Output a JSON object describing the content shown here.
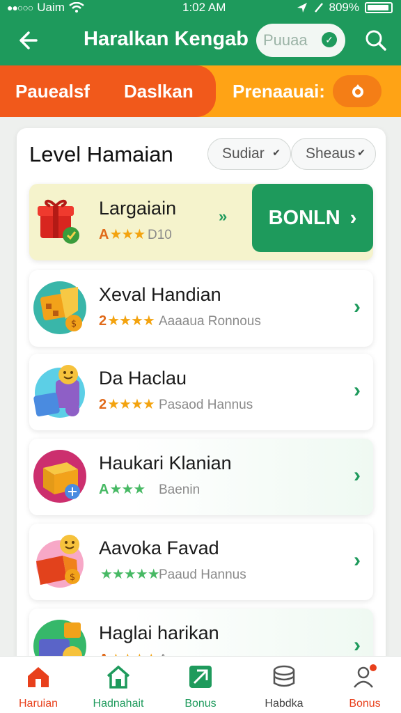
{
  "status_bar": {
    "carrier": "Uaim",
    "time": "1:02 AM",
    "battery": "809%"
  },
  "app_bar": {
    "title": "Haralkan Kengab",
    "pill_label": "Puuaa"
  },
  "tabs": [
    {
      "label": "Pauealsf"
    },
    {
      "label": "Daslkan"
    },
    {
      "label": "Prenaauai:"
    }
  ],
  "section": {
    "title": "Level Hamaian",
    "filters": [
      {
        "label": "Sudiar"
      },
      {
        "label": "Sheaus"
      }
    ]
  },
  "featured": {
    "name": "Largaiain",
    "rating_prefix": "A",
    "stars": "★★★",
    "meta": "D10",
    "action_label": "BONLN",
    "action_chevron": "›",
    "arrow": "»"
  },
  "items": [
    {
      "name": "Xeval Handian",
      "rating_prefix": "2",
      "stars": "★★★★",
      "meta": "Aaaaua Ronnous"
    },
    {
      "name": "Da Haclau",
      "rating_prefix": "2",
      "stars": "★★★★",
      "meta": "Pasaod Hannus"
    },
    {
      "name": "Haukari Klanian",
      "rating_prefix": "A",
      "stars": "★★★",
      "meta": "Baenin"
    },
    {
      "name": "Aavoka Favad",
      "rating_prefix": "",
      "stars": "★★★★★",
      "meta": "Paaud Hannus"
    },
    {
      "name": "Haglai harikan",
      "rating_prefix": "A",
      "stars": "★★★★",
      "meta": "Annus"
    }
  ],
  "bottom_nav": [
    {
      "label": "Haruian"
    },
    {
      "label": "Hadnahait"
    },
    {
      "label": "Bonus"
    },
    {
      "label": "Habdka"
    },
    {
      "label": "Bonus"
    }
  ],
  "colors": {
    "primary": "#1e9a5c",
    "tab_red": "#f1591b",
    "tab_orange": "#ffa315",
    "star": "#f3a30f"
  }
}
